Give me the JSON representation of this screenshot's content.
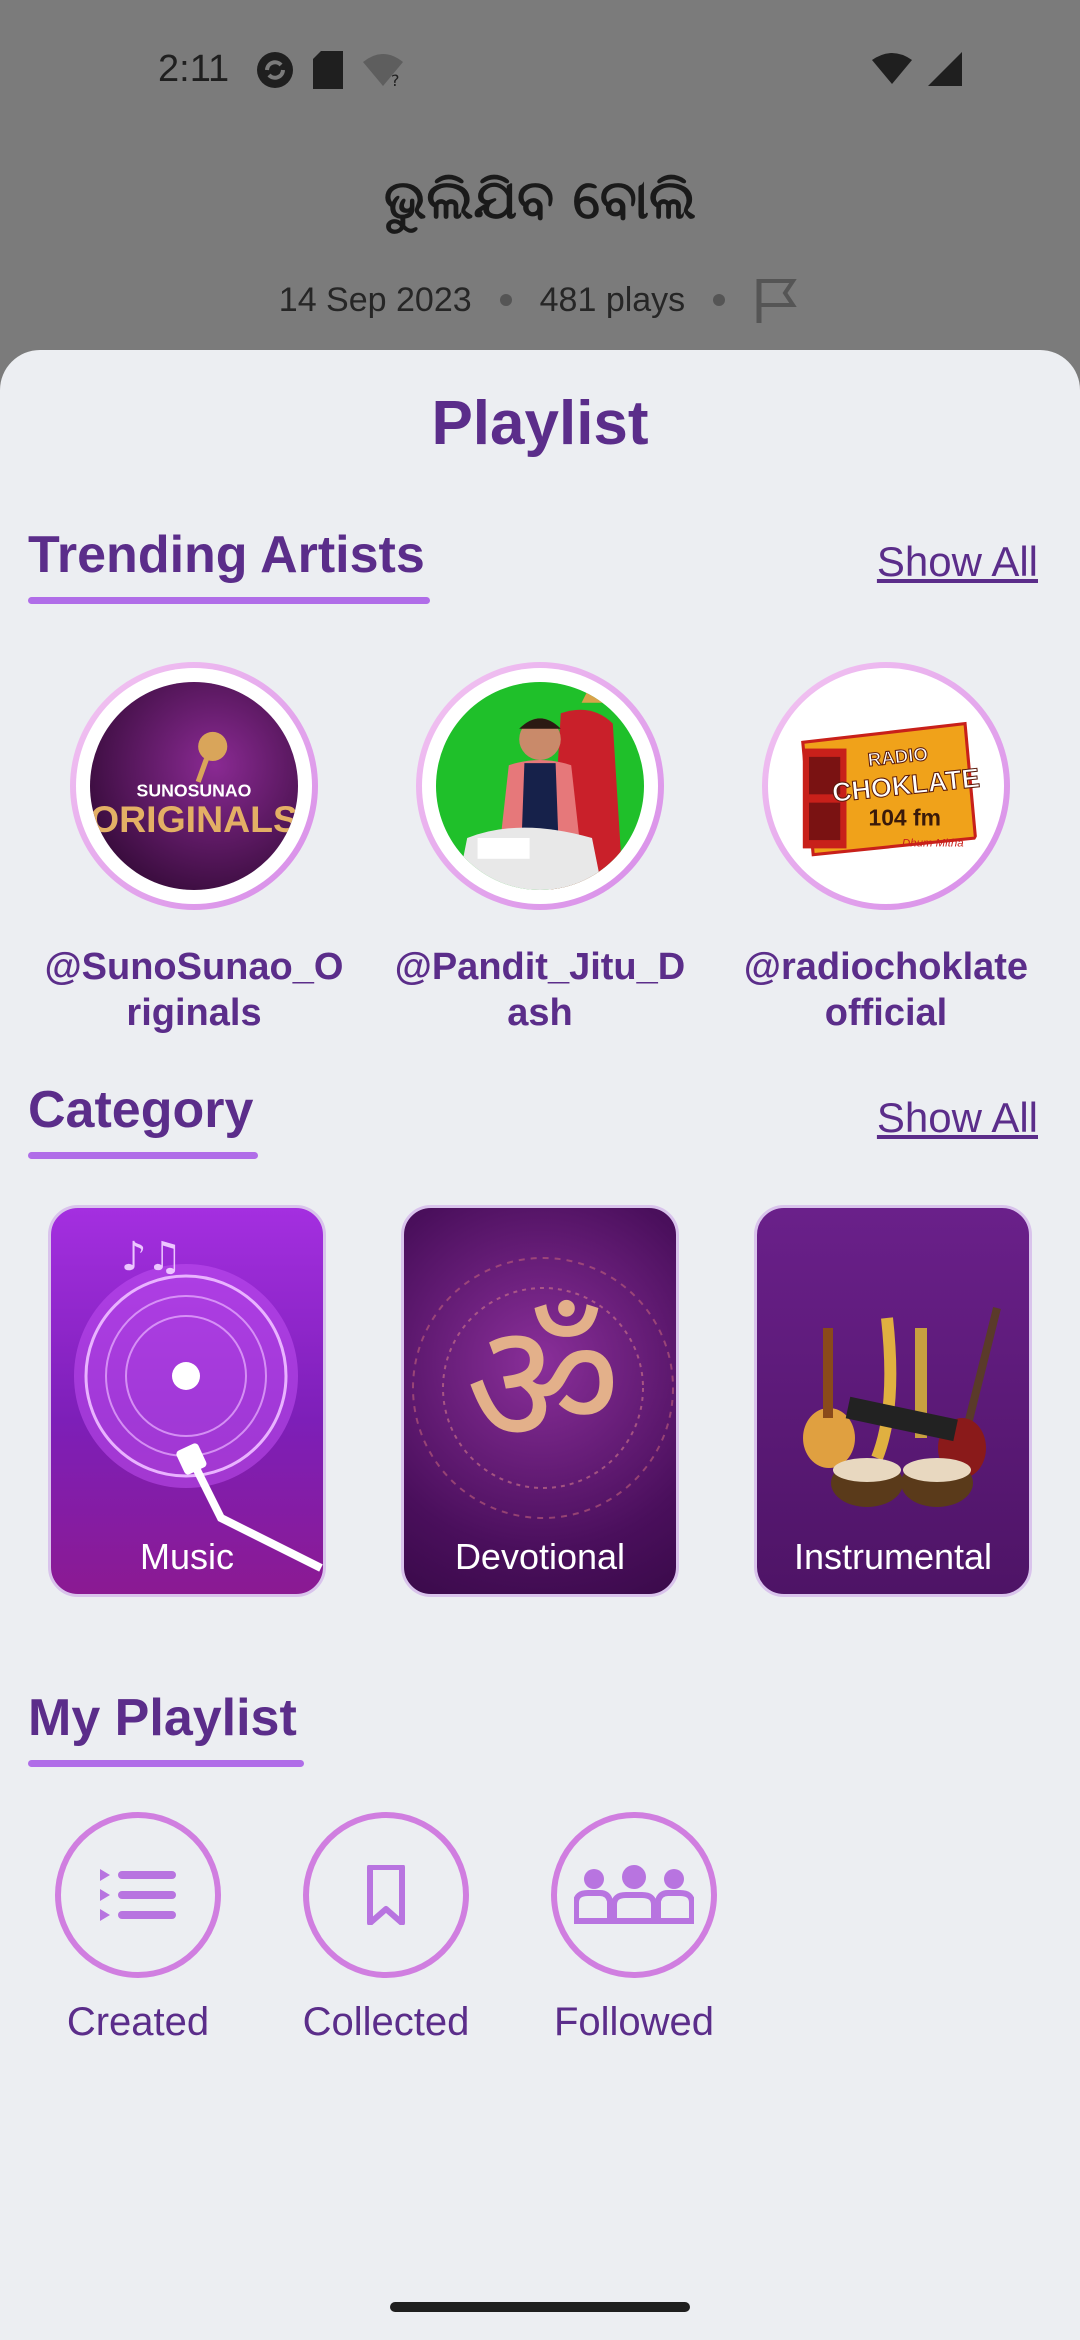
{
  "status_bar": {
    "time": "2:11"
  },
  "background": {
    "title": "ଭୁଲିଯିବ ବୋଲି",
    "date": "14 Sep 2023",
    "plays": "481 plays"
  },
  "sheet": {
    "title": "Playlist",
    "trending": {
      "heading": "Trending Artists",
      "show_all": "Show All",
      "artists": [
        {
          "handle": "@SunoSunao_Originals",
          "logo_text_1": "SUNOSUNAO",
          "logo_text_2": "ORIGINALS"
        },
        {
          "handle": "@Pandit_Jitu_Dash"
        },
        {
          "handle": "@radiochoklateofficial",
          "logo_text_1": "RADIO",
          "logo_text_2": "CHOKLATE",
          "logo_text_3": "104 fm",
          "logo_text_4": "Dhum Mitha"
        }
      ]
    },
    "category": {
      "heading": "Category",
      "show_all": "Show All",
      "items": [
        {
          "label": "Music"
        },
        {
          "label": "Devotional"
        },
        {
          "label": "Instrumental"
        }
      ]
    },
    "my_playlist": {
      "heading": "My Playlist",
      "items": [
        {
          "label": "Created",
          "icon": "list-icon"
        },
        {
          "label": "Collected",
          "icon": "bookmark-icon"
        },
        {
          "label": "Followed",
          "icon": "group-icon"
        }
      ]
    }
  },
  "colors": {
    "accent": "#5b2d8a",
    "accent_light": "#b06de8",
    "sheet_bg": "#eceef2"
  }
}
